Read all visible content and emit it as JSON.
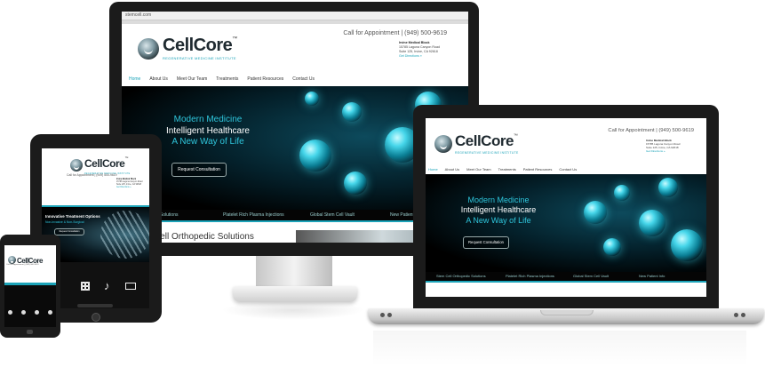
{
  "brand": {
    "name": "CellCore",
    "tm": "™",
    "tagline": "REGENERATIVE MEDICINE INSTITUTE"
  },
  "contact": {
    "phone_line": "Call for Appointment | (949) 500-9619",
    "address_name": "Irvine Medical Block",
    "address_1": "15785 Laguna Canyon Road",
    "address_2": "Suite 125, Irvine, CA 92618",
    "directions": "Get Directions »"
  },
  "monitor": {
    "url": "stemcell.com"
  },
  "nav": {
    "items": [
      "Home",
      "About Us",
      "Meet Our Team",
      "Treatments",
      "Patient Resources",
      "Contact Us"
    ]
  },
  "hero": {
    "line1": "Modern Medicine",
    "line2": "Intelligent Healthcare",
    "line3": "A New Way of Life",
    "cta": "Request Consultation"
  },
  "services": {
    "items": [
      "Stem Cell Orthopedic Solutions",
      "Platelet Rich Plasma Injections",
      "Global Stem Cell Vault",
      "New Patient Info"
    ]
  },
  "monitor_below": {
    "heading": "Cell Orthopedic Solutions"
  },
  "tablet": {
    "promo_title": "Innovative Treatment Options",
    "promo_sub": "Non-Invasive & Non-Surgical",
    "cta": "Request Consultation"
  },
  "colors": {
    "accent": "#1ba3b8",
    "device_frame": "#1b1b1b"
  }
}
